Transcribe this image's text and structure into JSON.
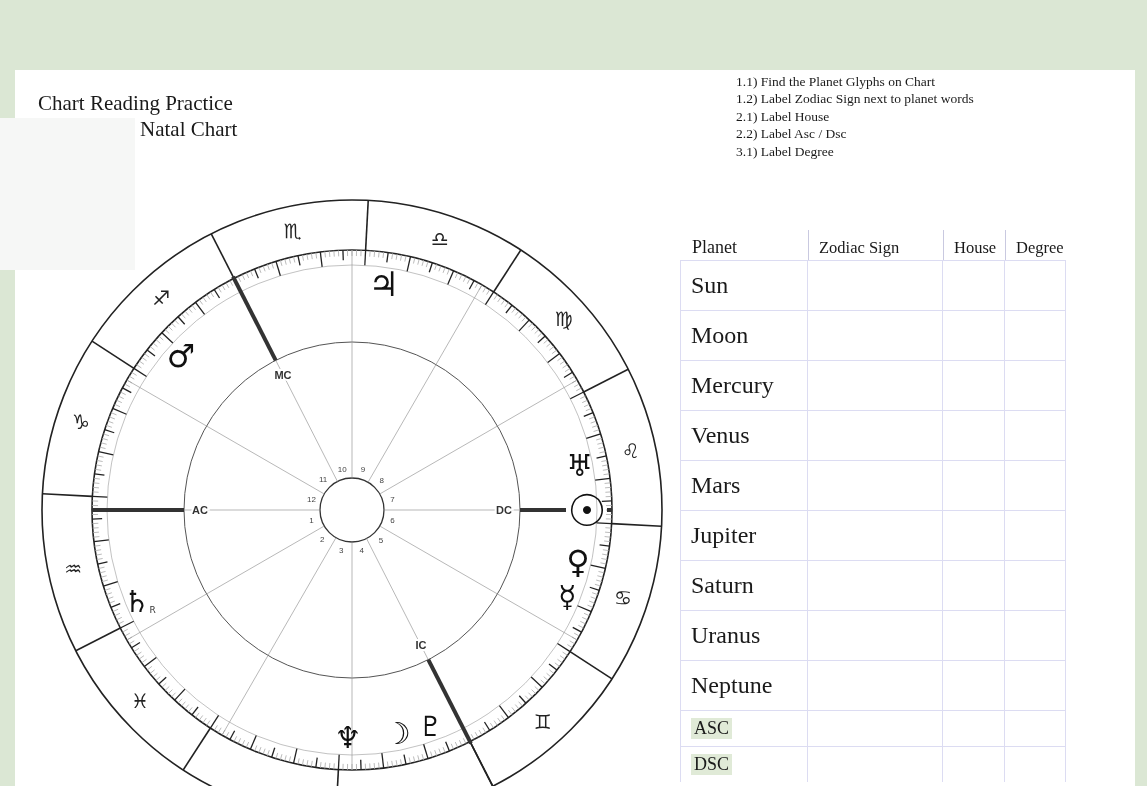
{
  "document": {
    "title": "Chart Reading Practice",
    "subtitle": "Natal Chart"
  },
  "instructions": [
    "1.1) Find the Planet Glyphs on Chart",
    "1.2) Label Zodiac Sign next to planet words",
    "2.1) Label House",
    "2.2) Label Asc / Dsc",
    "3.1) Label Degree"
  ],
  "natal_chart": {
    "zodiac_signs": [
      "♏",
      "♎",
      "♐",
      "♍",
      "♑",
      "♌",
      "♒",
      "♋",
      "♓",
      "♊"
    ],
    "planets": [
      {
        "glyph": "♃"
      },
      {
        "glyph": "♂"
      },
      {
        "glyph": "♅"
      },
      {
        "glyph": "☉"
      },
      {
        "glyph": "♀"
      },
      {
        "glyph": "♄",
        "retrograde_mark": "R"
      },
      {
        "glyph": "☿"
      },
      {
        "glyph": "♆"
      },
      {
        "glyph": "☽"
      },
      {
        "glyph": "♇"
      }
    ],
    "angles": [
      "AC",
      "DC",
      "MC",
      "IC"
    ],
    "house_numbers": [
      "1",
      "2",
      "3",
      "4",
      "5",
      "6",
      "7",
      "8",
      "9",
      "10",
      "11",
      "12"
    ]
  },
  "table": {
    "columns": [
      "Planet",
      "Zodiac Sign",
      "House",
      "Degree"
    ],
    "rows": [
      {
        "planet": "Sun",
        "highlighted": false
      },
      {
        "planet": "Moon",
        "highlighted": false
      },
      {
        "planet": "Mercury",
        "highlighted": false
      },
      {
        "planet": "Venus",
        "highlighted": false
      },
      {
        "planet": "Mars",
        "highlighted": false
      },
      {
        "planet": "Jupiter",
        "highlighted": false
      },
      {
        "planet": "Saturn",
        "highlighted": false
      },
      {
        "planet": "Uranus",
        "highlighted": false
      },
      {
        "planet": "Neptune",
        "highlighted": false
      },
      {
        "planet": "ASC",
        "highlighted": true
      },
      {
        "planet": "DSC",
        "highlighted": true
      }
    ]
  }
}
